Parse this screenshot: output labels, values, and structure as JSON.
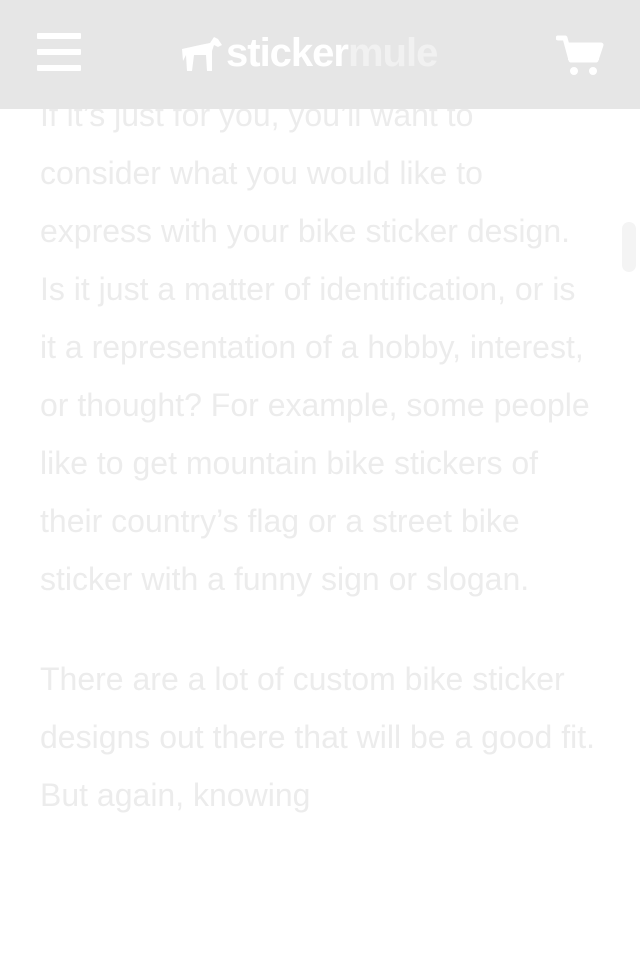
{
  "header": {
    "logo_part1": "sticker",
    "logo_part2": "mule",
    "menu_icon": "hamburger-menu-icon",
    "cart_icon": "shopping-cart-icon"
  },
  "article": {
    "paragraphs": [
      "If it’s just for you, you’ll want to consider what you would like to express with your bike sticker design. Is it just a matter of identification, or is it a representation of a hobby, interest, or thought? For example, some people like to get mountain bike stickers of their country’s flag or a street bike sticker with a funny sign or slogan.",
      "There are a lot of custom bike sticker designs out there that will be a good fit. But again, knowing"
    ]
  },
  "colors": {
    "header_bg": "#e6e6e6",
    "header_fg": "#ffffff",
    "text": "#ececec",
    "page_bg": "#ffffff"
  }
}
